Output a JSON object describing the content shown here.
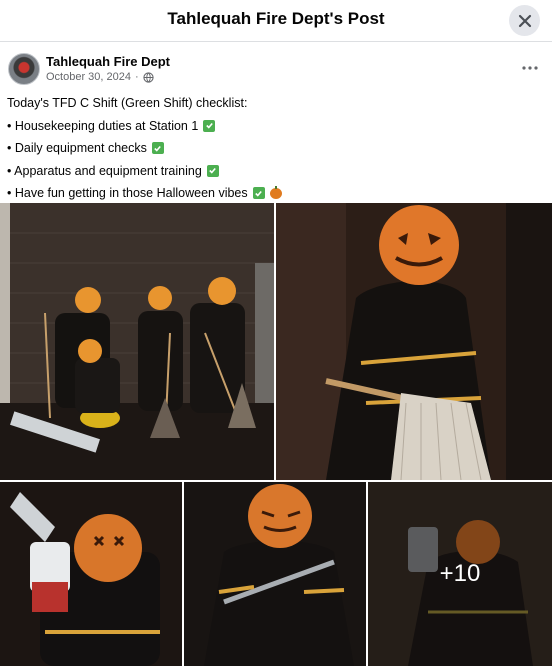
{
  "dialog": {
    "title": "Tahlequah Fire Dept's Post",
    "close_icon": "close-icon"
  },
  "post": {
    "author": "Tahlequah Fire Dept",
    "date": "October 30, 2024",
    "separator": "·",
    "audience_icon": "globe-icon",
    "more_icon": "more-options-icon",
    "intro": "Today's TFD C Shift (Green Shift) checklist:",
    "items": [
      {
        "text": "• Housekeeping duties at Station 1",
        "emoji": "check"
      },
      {
        "text": "• Daily equipment checks",
        "emoji": "check"
      },
      {
        "text": "• Apparatus and equipment training",
        "emoji": "check"
      },
      {
        "text": "• Have fun getting in those Halloween vibes",
        "emoji": "check-pumpkin"
      }
    ]
  },
  "gallery": {
    "photos": [
      {
        "subject": "firefighters-with-pumpkin-heads-posing-with-brooms"
      },
      {
        "subject": "pumpkin-head-firefighter-holding-mop"
      },
      {
        "subject": "pumpkin-head-firefighter-with-chainsaw"
      },
      {
        "subject": "pumpkin-head-firefighter-with-halligan-bar"
      },
      {
        "subject": "pumpkin-head-firefighter-with-chainsaw-dark"
      }
    ],
    "more_count_label": "+10"
  },
  "colors": {
    "accent_green": "#4caf50",
    "text_secondary": "#65676b",
    "pumpkin_orange": "#e07b1f"
  }
}
